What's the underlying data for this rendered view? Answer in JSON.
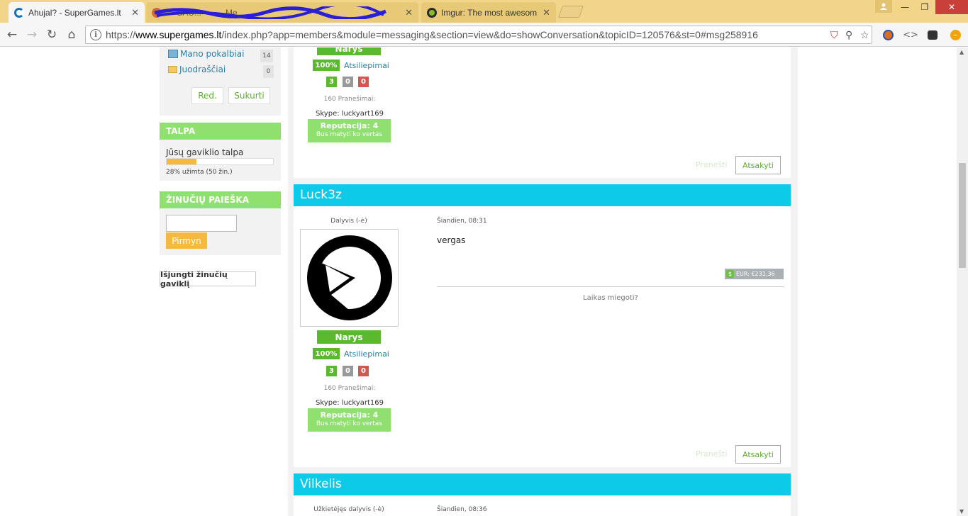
{
  "browser": {
    "tabs": [
      {
        "title": "Ahujal? - SuperGames.lt",
        "favicon_color": "#1a6fb5"
      },
      {
        "title": "— SAU... —   — Me...",
        "favicon_color": "#d46b2a"
      },
      {
        "title": "Imgur: The most awesom",
        "favicon_color": "#85bf25"
      }
    ],
    "url_prefix": "https://",
    "url_host": "www.supergames.lt",
    "url_path": "/index.php?app=members&module=messaging&section=view&do=showConversation&topicID=120576&st=0#msg258916"
  },
  "sidebar": {
    "folders": [
      {
        "label": "Mano pokalbiai",
        "count": "14"
      },
      {
        "label": "Juodraščiai",
        "count": "0"
      }
    ],
    "edit_label": "Red.",
    "create_label": "Sukurti",
    "storage": {
      "header": "TALPA",
      "label": "Jūsų gaviklio talpa",
      "used_fraction": 0.28,
      "note": "28% užimta (50 žin.)"
    },
    "search": {
      "header": "ŽINUČIŲ PAIEŠKA",
      "button": "Pirmyn"
    },
    "disable_label": "Išjungti žinučių gaviklį"
  },
  "posts": [
    {
      "rank": "Narys",
      "feedback_pct": "100%",
      "feedback_link": "Atsiliepimai",
      "scores": [
        "3",
        "0",
        "0"
      ],
      "post_count": "160 Pranešimai:",
      "skype": "Skype: luckyart169",
      "rep_title": "Reputacija: 4",
      "rep_sub": "Bus matyti ko vertas",
      "report": "Pranešti",
      "reply": "Atsakyti"
    },
    {
      "author": "Luck3z",
      "role": "Dalyvis (-ė)",
      "date": "Šiandien, 08:31",
      "text": "vergas",
      "money": "EUR: €231,36",
      "signature": "Laikas miegoti?",
      "rank": "Narys",
      "feedback_pct": "100%",
      "feedback_link": "Atsiliepimai",
      "scores": [
        "3",
        "0",
        "0"
      ],
      "post_count": "160 Pranešimai:",
      "skype": "Skype: luckyart169",
      "rep_title": "Reputacija: 4",
      "rep_sub": "Bus matyti ko vertas",
      "report": "Pranešti",
      "reply": "Atsakyti"
    },
    {
      "author": "Vilkelis",
      "role": "Užkietėjęs dalyvis (-ė)",
      "date": "Šiandien, 08:36"
    }
  ]
}
